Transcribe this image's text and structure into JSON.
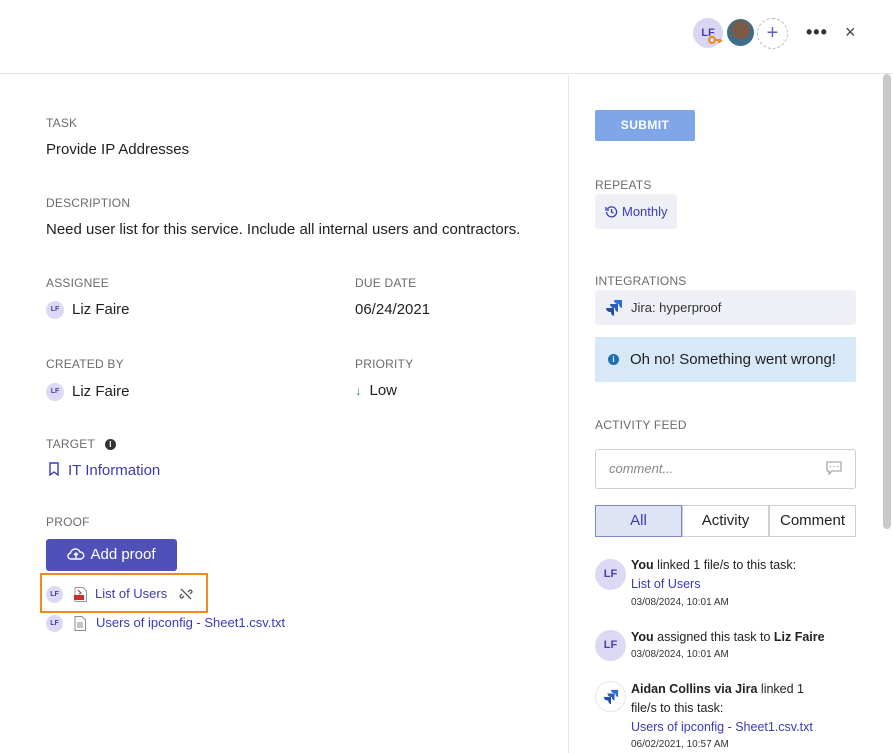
{
  "header": {
    "owner_initials": "LF",
    "add_member_symbol": "+",
    "more_symbol": "•••",
    "close_symbol": "×"
  },
  "task": {
    "label": "TASK",
    "value": "Provide IP Addresses"
  },
  "description": {
    "label": "DESCRIPTION",
    "value": "Need user list for this service. Include all internal users and contractors."
  },
  "assignee": {
    "label": "ASSIGNEE",
    "initials": "LF",
    "name": "Liz Faire"
  },
  "due_date": {
    "label": "DUE DATE",
    "value": "06/24/2021"
  },
  "created_by": {
    "label": "CREATED BY",
    "initials": "LF",
    "name": "Liz Faire"
  },
  "priority": {
    "label": "PRIORITY",
    "arrow": "↓",
    "value": "Low",
    "arrow_color": "#2e9a5b"
  },
  "target": {
    "label": "TARGET",
    "info": "i",
    "value": "IT Information"
  },
  "proof": {
    "label": "PROOF",
    "add_button": "Add proof",
    "files": [
      {
        "initials": "LF",
        "name": "List of Users",
        "type": "pdf"
      },
      {
        "initials": "LF",
        "name": "Users of ipconfig - Sheet1.csv.txt",
        "type": "txt"
      }
    ]
  },
  "sidebar": {
    "submit": "SUBMIT",
    "repeats_label": "REPEATS",
    "repeats_value": "Monthly",
    "integrations_label": "INTEGRATIONS",
    "integration_value": "Jira: hyperproof",
    "error_icon": "i",
    "error_message": "Oh no! Something went wrong!",
    "activity_label": "ACTIVITY FEED",
    "comment_placeholder": "comment...",
    "filters": [
      "All",
      "Activity",
      "Comment"
    ],
    "active_filter": "All",
    "feed": [
      {
        "avatar": "LF",
        "actor": "You",
        "action": " linked 1 file/s to this task:",
        "target": "List of Users",
        "time": "03/08/2024, 10:01 AM"
      },
      {
        "avatar": "LF",
        "actor": "You",
        "action": " assigned this task to ",
        "target": "Liz Faire",
        "time": "03/08/2024, 10:01 AM"
      },
      {
        "avatar": "jira",
        "actor": "Aidan Collins via Jira",
        "action": " linked 1 file/s to this task:",
        "target": "Users of ipconfig - Sheet1.csv.txt",
        "time": "06/02/2021, 10:57 AM"
      }
    ]
  },
  "colors": {
    "brand": "#5051b8",
    "highlight": "#f08a1c",
    "submit": "#7fa6e8",
    "error_bg": "#d7e8f8"
  }
}
